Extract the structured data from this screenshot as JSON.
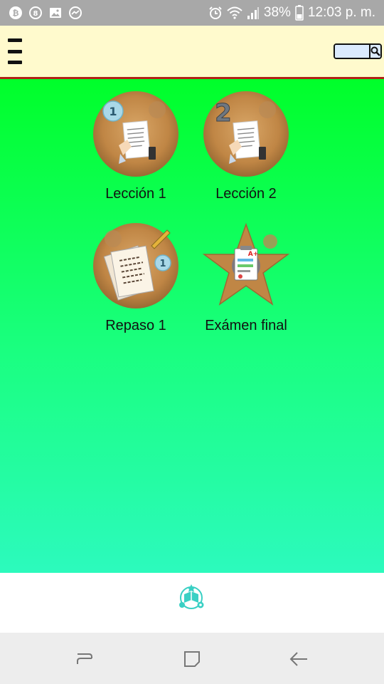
{
  "status_bar": {
    "battery": "38%",
    "time": "12:03 p. m."
  },
  "header": {
    "search_placeholder": ""
  },
  "lessons": [
    {
      "label": "Lección 1"
    },
    {
      "label": "Lección 2"
    },
    {
      "label": "Repaso 1"
    },
    {
      "label": "Exámen final"
    }
  ],
  "icons": {
    "menu": "hamburger-menu-icon",
    "search": "magnifier-icon",
    "bottom": "learning-hub-icon",
    "nav_recents": "recents-icon",
    "nav_home": "home-icon",
    "nav_back": "back-arrow-icon"
  },
  "colors": {
    "header_bg": "#fffacd",
    "header_border": "#b22217",
    "main_top": "#00ff2a",
    "main_bottom": "#2cfabd",
    "accent": "#3ad0c4"
  }
}
